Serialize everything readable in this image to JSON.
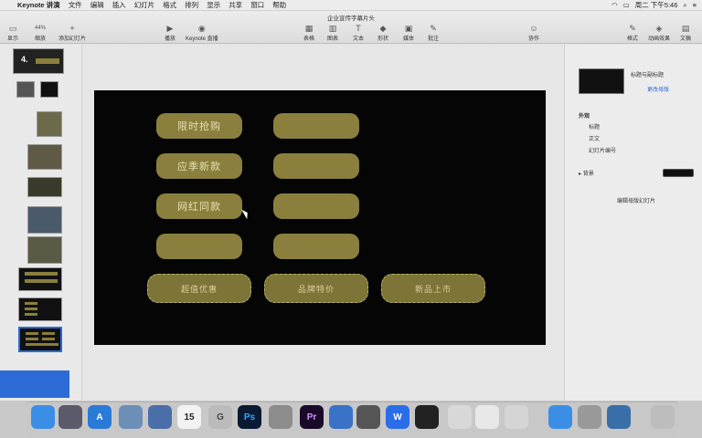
{
  "menubar": {
    "apple": "",
    "app": "Keynote 讲演",
    "items": [
      "文件",
      "编辑",
      "插入",
      "幻灯片",
      "格式",
      "排列",
      "显示",
      "共享",
      "窗口",
      "帮助"
    ],
    "clock": "周二 下午5:46"
  },
  "toolbar": {
    "doc_title": "企业宣传字幕片头",
    "items": [
      {
        "label": "显示",
        "icon": "▭"
      },
      {
        "label": "缩放",
        "icon": "44%"
      },
      {
        "label": "添加幻灯片",
        "icon": "+"
      },
      {
        "label": "播放",
        "icon": "▶"
      },
      {
        "label": "Keynote 直播",
        "icon": "◉"
      },
      {
        "label": "表格",
        "icon": "▦"
      },
      {
        "label": "图表",
        "icon": "▥"
      },
      {
        "label": "文本",
        "icon": "T"
      },
      {
        "label": "形状",
        "icon": "◆"
      },
      {
        "label": "媒体",
        "icon": "▣"
      },
      {
        "label": "批注",
        "icon": "✎"
      },
      {
        "label": "协作",
        "icon": "☺"
      },
      {
        "label": "格式",
        "icon": "✎"
      },
      {
        "label": "动画效果",
        "icon": "◈"
      },
      {
        "label": "文稿",
        "icon": "▤"
      }
    ]
  },
  "navigator": {
    "slides": [
      {
        "num": "4.",
        "selected": false
      },
      {
        "num": "",
        "selected": false
      },
      {
        "num": "",
        "selected": false
      },
      {
        "num": "",
        "selected": false
      },
      {
        "num": "",
        "selected": false
      },
      {
        "num": "",
        "selected": false
      },
      {
        "num": "",
        "selected": false
      },
      {
        "num": "",
        "selected": false
      },
      {
        "num": "",
        "selected": false
      },
      {
        "num": "",
        "selected": true
      }
    ]
  },
  "slide": {
    "buttons": [
      {
        "label": "限时抢购"
      },
      {
        "label": ""
      },
      {
        "label": "应季新款"
      },
      {
        "label": ""
      },
      {
        "label": "网红同款"
      },
      {
        "label": ""
      },
      {
        "label": ""
      },
      {
        "label": ""
      },
      {
        "label": "超值优惠"
      },
      {
        "label": "品牌特价"
      },
      {
        "label": "新品上市"
      }
    ]
  },
  "inspector": {
    "layout_name": "标题与副标题",
    "change_master": "更改母版",
    "appearance": "外观",
    "opt1": "标题",
    "opt2": "正文",
    "opt3": "幻灯片编号",
    "background": "背景",
    "edit_master": "编辑母版幻灯片"
  },
  "dock": {
    "apps": [
      {
        "name": "Finder",
        "label": "",
        "color": "#3a8ee6"
      },
      {
        "name": "Launchpad",
        "label": "",
        "color": "#5a5a6a"
      },
      {
        "name": "App Store",
        "label": "A",
        "color": "#2a7ad8"
      },
      {
        "name": "Preview",
        "label": "",
        "color": "#6c8fb8"
      },
      {
        "name": "Tools",
        "label": "",
        "color": "#4a6ea8"
      },
      {
        "name": "Calendar",
        "label": "15",
        "color": "#f2f2f2"
      },
      {
        "name": "Refresh",
        "label": "G",
        "color": "#bbbbbb"
      },
      {
        "name": "Photoshop",
        "label": "Ps",
        "color": "#0a1a33"
      },
      {
        "name": "Settings",
        "label": "",
        "color": "#8c8c8c"
      },
      {
        "name": "Premiere",
        "label": "Pr",
        "color": "#1a0a2a"
      },
      {
        "name": "Keynote",
        "label": "",
        "color": "#3a72c8"
      },
      {
        "name": "Camera",
        "label": "",
        "color": "#555"
      },
      {
        "name": "WPS",
        "label": "W",
        "color": "#2a6de8"
      },
      {
        "name": "QQ",
        "label": "",
        "color": "#222"
      },
      {
        "name": "Sheep",
        "label": "",
        "color": "#d8d8d8"
      },
      {
        "name": "Notes",
        "label": "",
        "color": "#e8e8e8"
      },
      {
        "name": "Monitor",
        "label": "",
        "color": "#d5d5d5"
      },
      {
        "name": "Cloud",
        "label": "",
        "color": "#3a8ee6"
      },
      {
        "name": "Disk",
        "label": "",
        "color": "#999"
      },
      {
        "name": "Search",
        "label": "",
        "color": "#3a6ea8"
      },
      {
        "name": "Trash",
        "label": "",
        "color": "#bdbdbd"
      }
    ]
  }
}
